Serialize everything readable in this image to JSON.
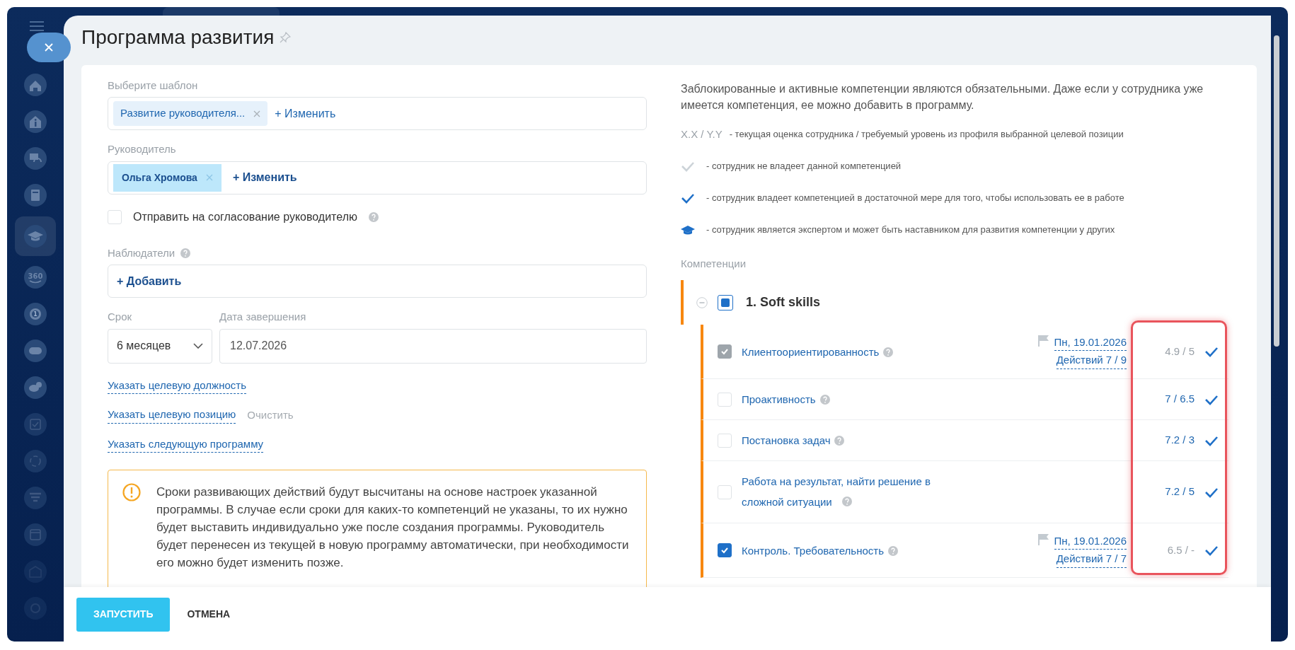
{
  "sidebar": {
    "items": [
      {
        "kind": "home",
        "selected": false
      },
      {
        "kind": "info",
        "selected": false
      },
      {
        "kind": "headset",
        "selected": false
      },
      {
        "kind": "book",
        "selected": false
      },
      {
        "kind": "cap",
        "selected": true
      },
      {
        "kind": "rotation",
        "text": "360",
        "selected": false
      },
      {
        "kind": "target",
        "text": "1",
        "selected": false
      },
      {
        "kind": "gamepad",
        "selected": false
      },
      {
        "kind": "chat",
        "selected": false
      },
      {
        "kind": "checkbox",
        "selected": false
      },
      {
        "kind": "cycle",
        "selected": false
      },
      {
        "kind": "funnel",
        "selected": false
      },
      {
        "kind": "calendar",
        "selected": false
      },
      {
        "kind": "box",
        "selected": false
      },
      {
        "kind": "gear",
        "selected": false
      }
    ]
  },
  "panel": {
    "title": "Программа развития",
    "pinned": false
  },
  "form": {
    "template": {
      "label": "Выберите шаблон",
      "tag": "Развитие руководителя...",
      "change": "+ Изменить"
    },
    "manager": {
      "label": "Руководитель",
      "tag": "Ольга Хромова",
      "change": "+ Изменить"
    },
    "approval": {
      "label": "Отправить на согласование руководителю",
      "checked": false
    },
    "observers": {
      "label": "Наблюдатели",
      "add": "+ Добавить"
    },
    "term": {
      "label": "Срок",
      "value": "6 месяцев"
    },
    "end_date": {
      "label": "Дата завершения",
      "value": "12.07.2026"
    },
    "links": [
      {
        "text": "Указать целевую должность"
      },
      {
        "text": "Указать целевую позицию",
        "clear": "Очистить"
      },
      {
        "text": "Указать следующую программу"
      }
    ],
    "warning": "Сроки развивающих действий будут высчитаны на основе настроек указанной программы. В случае если сроки для каких-то компетенций не указаны, то их нужно будет выставить индивидуально уже после создания программы. Руководитель будет перенесен из текущей в новую программу автоматически, при необходимости его можно будет изменить позже."
  },
  "info": {
    "text": "Заблокированные и активные компетенции являются обязательными. Даже если у сотрудника уже имеется компетенция, ее можно добавить в программу.",
    "legend": [
      {
        "kind": "score",
        "symbol": "X.X / Y.Y",
        "text": "- текущая оценка сотрудника / требуемый уровень из профиля выбранной целевой позиции"
      },
      {
        "kind": "none",
        "text": "- сотрудник не владеет данной компетенцией"
      },
      {
        "kind": "owns",
        "text": "- сотрудник владеет компетенцией в достаточной мере для того, чтобы использовать ее в работе"
      },
      {
        "kind": "expert",
        "text": "- сотрудник является экспертом и может быть наставником для развития компетенции у других"
      }
    ]
  },
  "competencies": {
    "label": "Компетенции",
    "groups": [
      {
        "title": "1. Soft skills",
        "expanded": true,
        "checked": true,
        "items": [
          {
            "kind": "owns",
            "name": "Клиентоориентированность",
            "checked": true,
            "disabled": true,
            "date": "Пн, 19.01.2026",
            "actions": "Действий 7 / 9",
            "score": "4.9 / 5",
            "met": false
          },
          {
            "kind": "owns",
            "name": "Проактивность",
            "checked": false,
            "disabled": false,
            "score": "7 / 6.5",
            "met": true
          },
          {
            "kind": "owns",
            "name": "Постановка задач",
            "checked": false,
            "disabled": false,
            "score": "7.2 / 3",
            "met": true
          },
          {
            "kind": "owns",
            "name": "Работа на результат, найти решение в сложной ситуации",
            "checked": false,
            "disabled": false,
            "score": "7.2 / 5",
            "met": true
          },
          {
            "kind": "owns",
            "name": "Контроль. Требовательность",
            "checked": true,
            "disabled": false,
            "date": "Пн, 19.01.2026",
            "actions": "Действий 7 / 7",
            "score": "6.5 / -",
            "met": false
          }
        ]
      }
    ]
  },
  "footer": {
    "buttons": [
      {
        "kind": "primary",
        "label": "ЗАПУСТИТЬ"
      },
      {
        "kind": "plain",
        "label": "ОТМЕНА"
      }
    ]
  }
}
